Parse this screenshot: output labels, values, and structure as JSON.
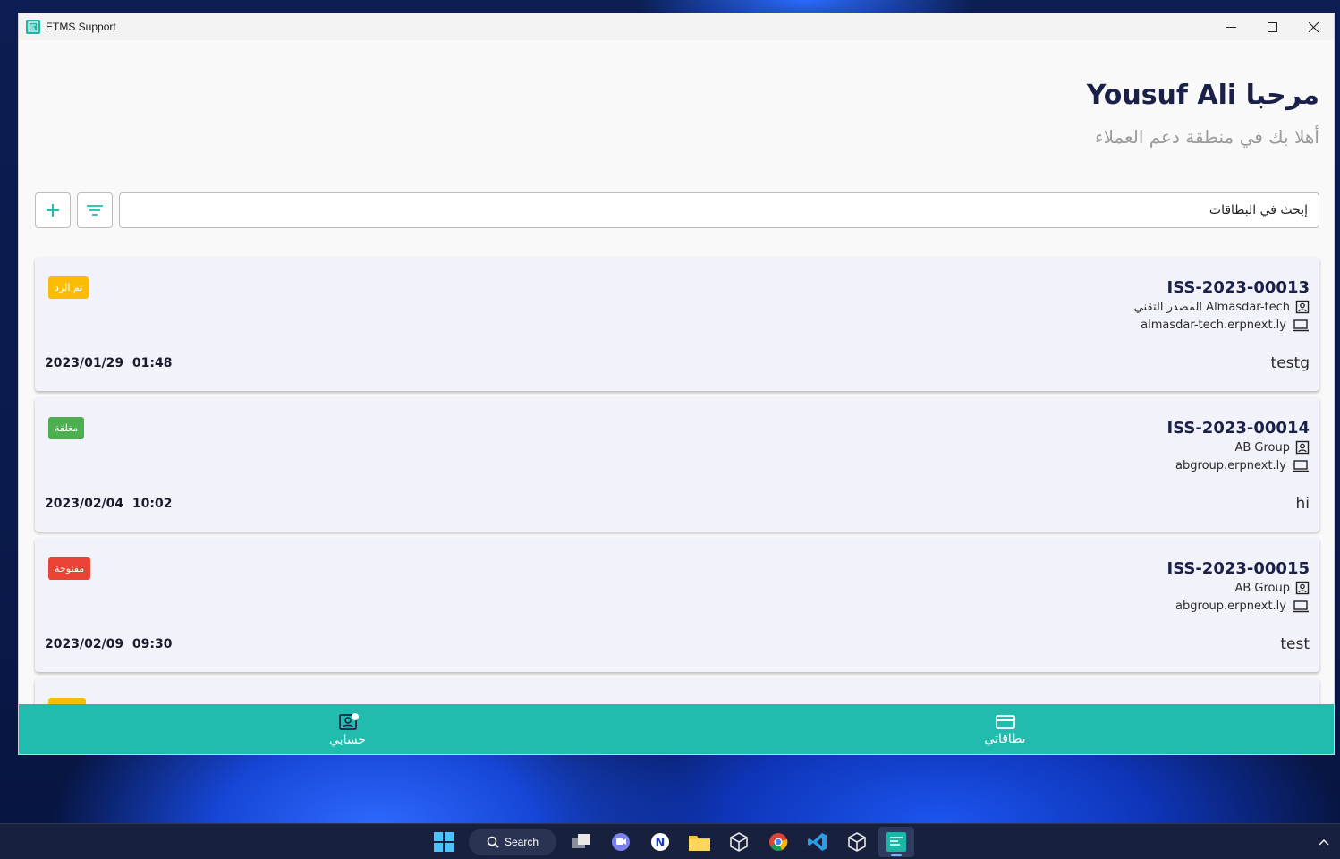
{
  "window": {
    "title": "ETMS Support",
    "controls": {
      "minimize": "—",
      "maximize": "☐",
      "close": "✕"
    }
  },
  "header": {
    "greeting": "مرحبا Yousuf Ali",
    "subtitle": "أهلا بك في منطقة دعم العملاء"
  },
  "toolbar": {
    "search_placeholder": "إبحث في البطاقات"
  },
  "tickets": [
    {
      "id": "ISS-2023-00013",
      "customer": "المصدر التقني Almasdar-tech",
      "site": "almasdar-tech.erpnext.ly",
      "date": "2023/01/29  01:48",
      "subject": "testg",
      "status": "تم الرد",
      "status_color": "#fbbc05"
    },
    {
      "id": "ISS-2023-00014",
      "customer": "AB Group",
      "site": "abgroup.erpnext.ly",
      "date": "2023/02/04  10:02",
      "subject": "hi",
      "status": "مغلقة",
      "status_color": "#4caf50"
    },
    {
      "id": "ISS-2023-00015",
      "customer": "AB Group",
      "site": "abgroup.erpnext.ly",
      "date": "2023/02/09  09:30",
      "subject": "test",
      "status": "مفتوحة",
      "status_color": "#ea4335"
    }
  ],
  "partial_ticket_status_color": "#fbbc05",
  "bottom_nav": {
    "account_label": "حسابي",
    "cards_label": "بطاقاتي"
  },
  "taskbar": {
    "search_label": "Search"
  },
  "colors": {
    "accent": "#21bcae",
    "title_text": "#1b2048"
  }
}
